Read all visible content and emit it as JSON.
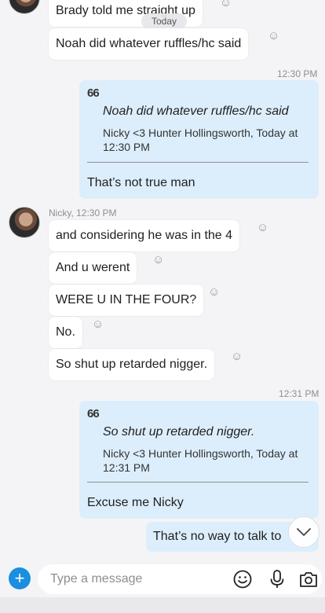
{
  "top_partial": {
    "message_1": "Brady told me straight up",
    "message_2": "Noah did whatever ruffles/hc said",
    "today_label": "Today"
  },
  "reply_1": {
    "timestamp": "12:30 PM",
    "quote_mark": "66",
    "quoted_text": "Noah did whatever ruffles/hc said",
    "quote_source_line1": "Nicky <3 Hunter Hollingsworth, Today at",
    "quote_source_line2": "12:30 PM",
    "reply_text": "That’s not true man"
  },
  "group_2": {
    "sender_meta": "Nicky, 12:30 PM",
    "messages": [
      "and considering he was in the 4",
      "And u werent",
      "WERE U IN THE FOUR?",
      "No.",
      "So shut up retarded nigger."
    ]
  },
  "reply_2": {
    "timestamp": "12:31 PM",
    "quote_mark": "66",
    "quoted_text": "So shut up retarded nigger.",
    "quote_source_line1": "Nicky <3 Hunter Hollingsworth, Today at",
    "quote_source_line2": "12:31 PM",
    "reply_text": "Excuse me Nicky"
  },
  "last_message": "That’s no way to talk to",
  "composer": {
    "plus_label": "+",
    "placeholder": "Type a message"
  },
  "colors": {
    "outgoing_bubble": "#dceefc",
    "incoming_bubble": "#ffffff",
    "accent": "#1a8fe0"
  },
  "icons": [
    "smiley-icon",
    "microphone-icon",
    "camera-icon",
    "chevron-down-icon",
    "plus-icon"
  ]
}
